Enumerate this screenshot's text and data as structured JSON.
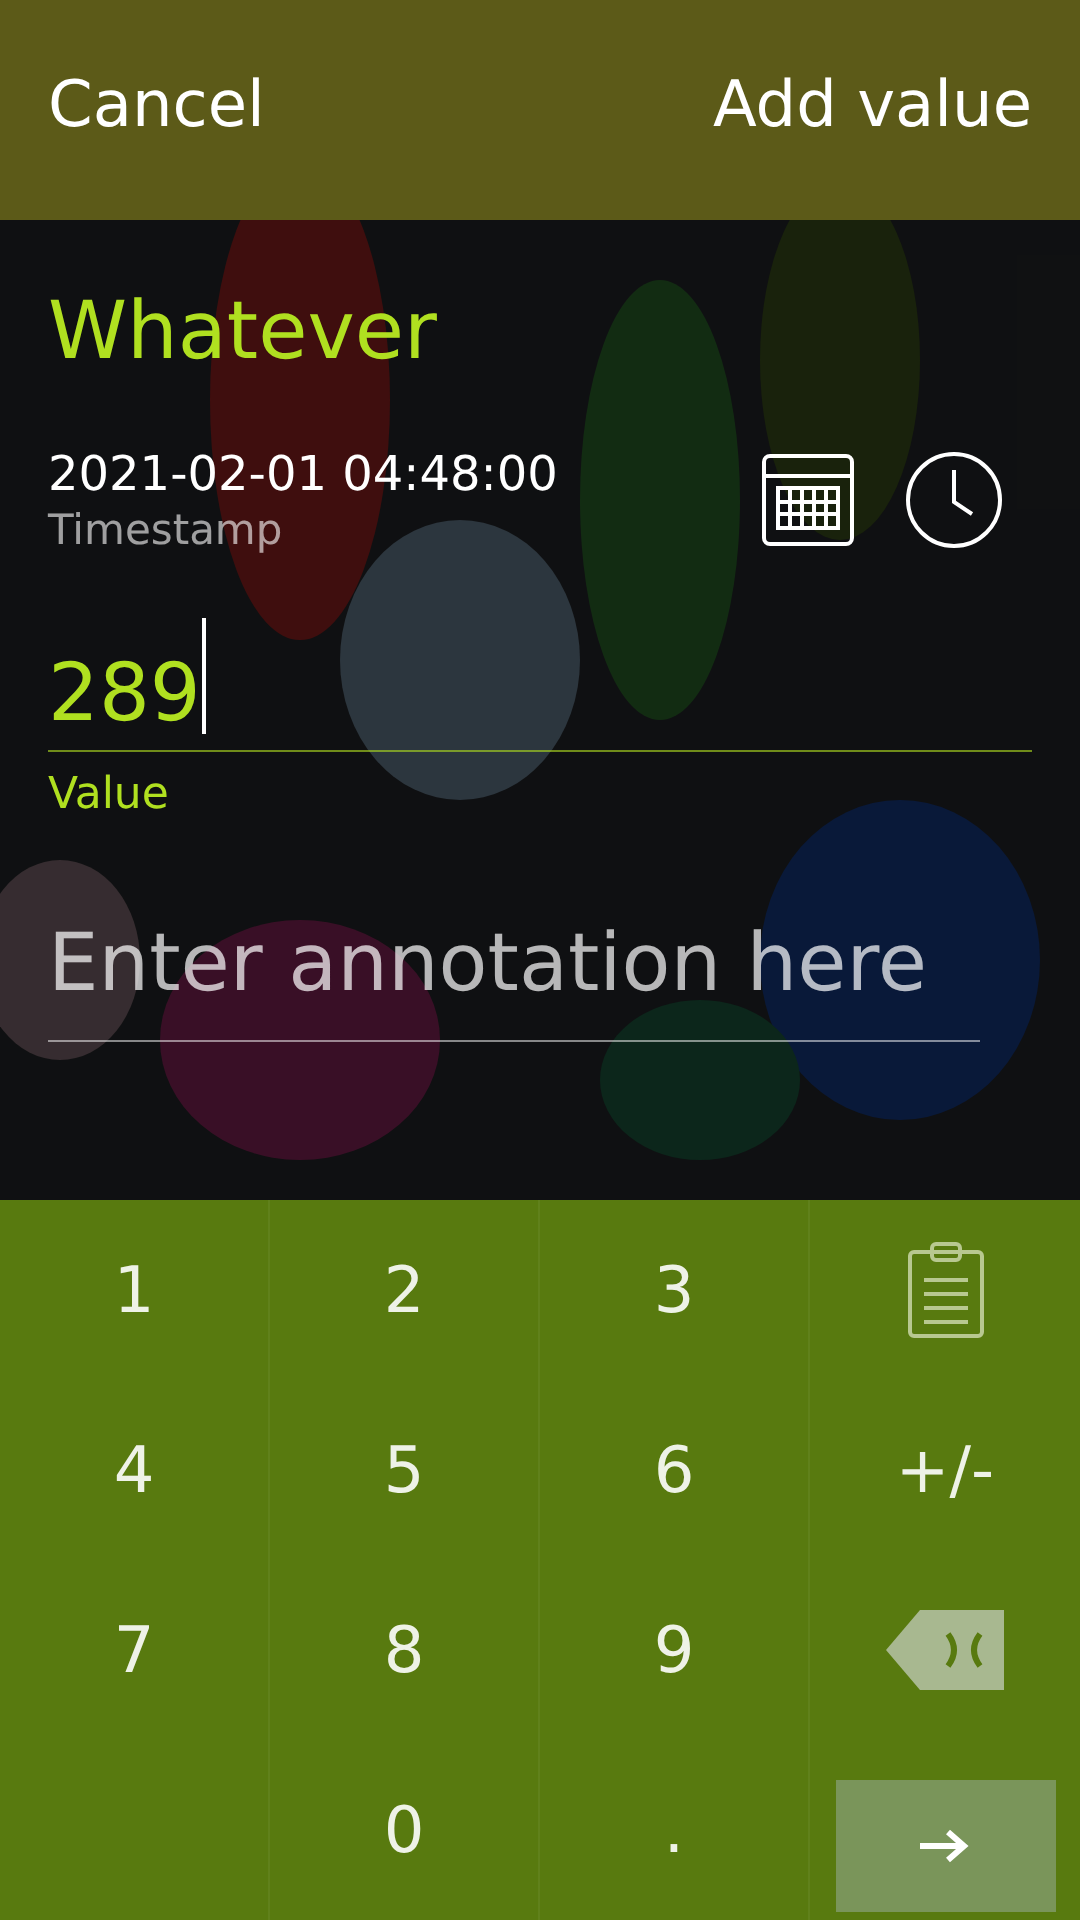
{
  "header": {
    "cancel": "Cancel",
    "accept": "Add value"
  },
  "title": "Whatever",
  "timestamp": {
    "value": "2021-02-01 04:48:00",
    "label": "Timestamp"
  },
  "value_field": {
    "value": "289",
    "label": "Value",
    "focused": true
  },
  "annotation_field": {
    "placeholder": "Enter annotation here"
  },
  "keyboard": {
    "keys": [
      {
        "kind": "char",
        "label": "1"
      },
      {
        "kind": "char",
        "label": "2"
      },
      {
        "kind": "char",
        "label": "3"
      },
      {
        "kind": "clipboard"
      },
      {
        "kind": "char",
        "label": "4"
      },
      {
        "kind": "char",
        "label": "5"
      },
      {
        "kind": "char",
        "label": "6"
      },
      {
        "kind": "char",
        "label": "+/-"
      },
      {
        "kind": "char",
        "label": "7"
      },
      {
        "kind": "char",
        "label": "8"
      },
      {
        "kind": "char",
        "label": "9"
      },
      {
        "kind": "backspace"
      },
      {
        "kind": "empty"
      },
      {
        "kind": "char",
        "label": "0"
      },
      {
        "kind": "char",
        "label": "."
      },
      {
        "kind": "enter"
      }
    ]
  }
}
